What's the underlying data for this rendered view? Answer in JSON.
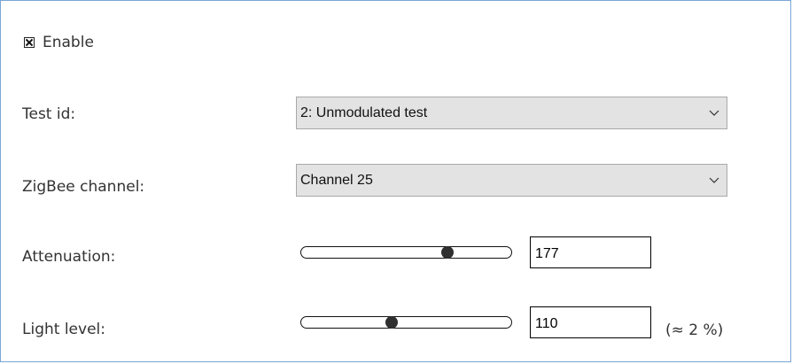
{
  "enable": {
    "label": "Enable",
    "checked": true
  },
  "test_id": {
    "label": "Test id:",
    "selected": "2: Unmodulated test"
  },
  "zigbee_channel": {
    "label": "ZigBee channel:",
    "selected": "Channel 25"
  },
  "attenuation": {
    "label": "Attenuation:",
    "value": "177",
    "slider_fraction": 0.694
  },
  "light_level": {
    "label": "Light level:",
    "value": "110",
    "percent_text": "(≈ 2 %)",
    "slider_fraction": 0.431
  },
  "colors": {
    "frame_border": "#7aa6d6",
    "select_background": "#e3e3e3",
    "label_text": "#333333"
  },
  "icons": {
    "checkbox": "checkbox-checked-icon",
    "dropdown": "chevron-down-icon",
    "slider_thumb": "slider-thumb-icon"
  }
}
